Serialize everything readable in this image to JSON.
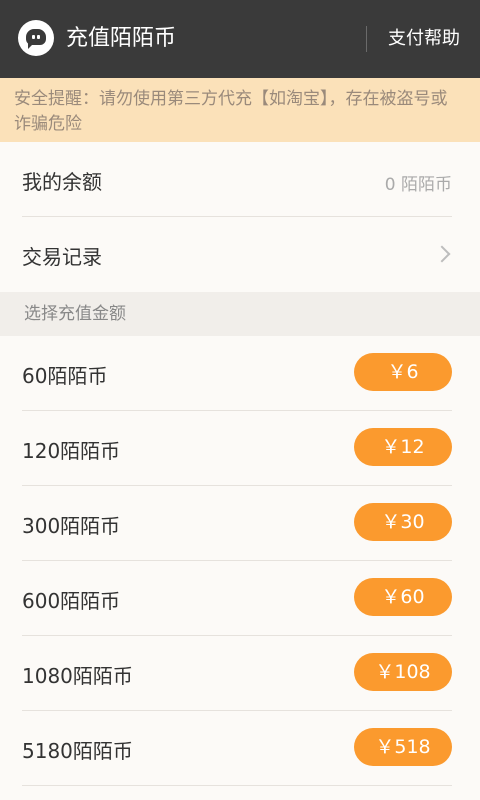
{
  "header": {
    "title": "充值陌陌币",
    "help_label": "支付帮助",
    "logo_icon": "momo-logo-icon",
    "background_color": "#3a3a3a"
  },
  "notice": {
    "text": "安全提醒：请勿使用第三方代充【如淘宝】，存在被盗号或诈骗危险"
  },
  "balance": {
    "label": "我的余额",
    "value": "0 陌陌币"
  },
  "history": {
    "label": "交易记录",
    "icon": "chevron-right-icon"
  },
  "section": {
    "title": "选择充值金额"
  },
  "options": [
    {
      "label": "60陌陌币",
      "price": "￥6"
    },
    {
      "label": "120陌陌币",
      "price": "￥12"
    },
    {
      "label": "300陌陌币",
      "price": "￥30"
    },
    {
      "label": "600陌陌币",
      "price": "￥60"
    },
    {
      "label": "1080陌陌币",
      "price": "￥108"
    },
    {
      "label": "5180陌陌币",
      "price": "￥518"
    }
  ],
  "colors": {
    "accent": "#fb9a2e",
    "notice_bg": "#fbe1b9",
    "page_bg": "#fcfaf7"
  }
}
